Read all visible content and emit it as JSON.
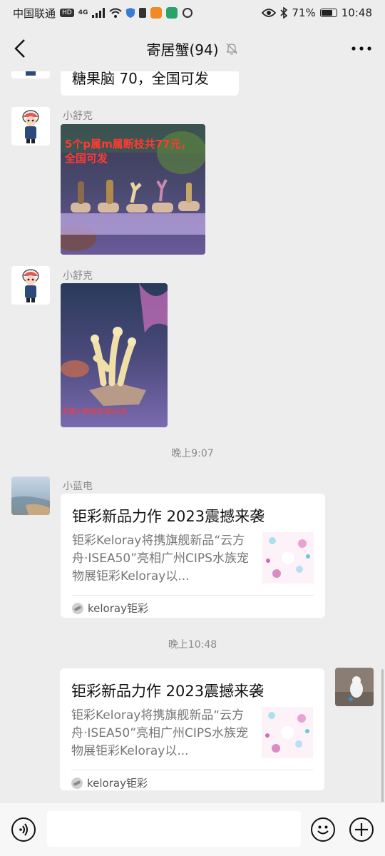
{
  "status_bar": {
    "carrier": "中国联通",
    "hd_badge": "HD",
    "network": "4G",
    "battery_percent": "71%",
    "battery_level": 0.71,
    "time": "10:48",
    "icons": [
      "signal-icon",
      "wifi-icon",
      "shield-icon",
      "sim-icon",
      "app-icon-orange",
      "app-icon-green",
      "circle-icon",
      "eye-icon",
      "bluetooth-icon",
      "battery-icon"
    ]
  },
  "nav": {
    "title": "寄居蟹(94)",
    "back_icon": "chevron-left-icon",
    "mute_icon": "bell-muted-icon",
    "more_icon": "more-icon"
  },
  "messages": {
    "partial_text": "糖果脑 70，全国可发",
    "msg1": {
      "sender": "小舒克",
      "image_caption": "5个p属m属断枝共77元，全国可发"
    },
    "msg2": {
      "sender": "小舒克",
      "image_caption": "凤凰+断枝奶油93元"
    },
    "time1": "晚上9:07",
    "msg3": {
      "sender": "小蓝电",
      "card": {
        "title": "钜彩新品力作 2023震撼来袭",
        "desc": "钜彩Keloray将携旗舰新品“云方舟·ISEA50”亮相广州CIPS水族宠物展钜彩Keloray以...",
        "source": "keloray钜彩"
      }
    },
    "time2": "晚上10:48",
    "msg4": {
      "card": {
        "title": "钜彩新品力作 2023震撼来袭",
        "desc": "钜彩Keloray将携旗舰新品“云方舟·ISEA50”亮相广州CIPS水族宠物展钜彩Keloray以...",
        "source": "keloray钜彩"
      }
    }
  },
  "input_bar": {
    "voice_icon": "voice-icon",
    "emoji_icon": "emoji-icon",
    "plus_icon": "plus-icon",
    "placeholder": ""
  },
  "colors": {
    "background": "#ededed",
    "bubble": "#ffffff",
    "caption_red": "#ff3b30",
    "meta_gray": "#8a8a8a"
  }
}
